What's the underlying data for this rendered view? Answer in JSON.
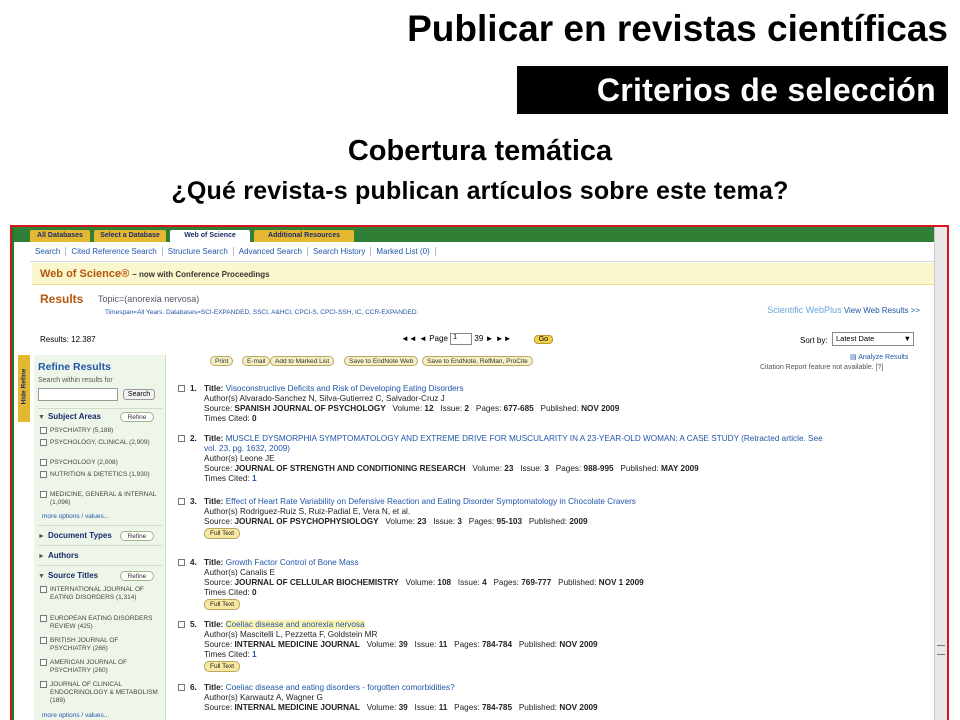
{
  "slide": {
    "title": "Publicar en revistas científicas",
    "section": "Criterios de selección",
    "subtitle": "Cobertura temática",
    "question": "¿Qué revista-s publican artículos sobre este tema?"
  },
  "tabs": [
    "All Databases",
    "Select a Database",
    "Web of Science",
    "Additional Resources"
  ],
  "nav": [
    "Search",
    "Cited Reference Search",
    "Structure Search",
    "Advanced Search",
    "Search History",
    "Marked List (0)"
  ],
  "wos": {
    "brand": "Web of Science®",
    "tagline": "– now with Conference Proceedings"
  },
  "results_header": {
    "label": "Results",
    "topic": "Topic=(anorexia nervosa)",
    "timespan": "Timespan=All Years. Databases=SCI-EXPANDED, SSCI, A&HCI, CPCI-S, CPCI-SSH, IC, CCR-EXPANDED.",
    "webplus_logo": "Scientific WebPlus",
    "webplus_link": "View Web Results >>",
    "count": "Results: 12.387",
    "page_label": "Page",
    "page_value": "1",
    "page_total": "39",
    "go": "Go",
    "sort_label": "Sort by:",
    "sort_value": "Latest Date"
  },
  "hide_refine": "Hide Refine",
  "sidebar": {
    "title": "Refine Results",
    "search_within": "Search within results for",
    "search_btn": "Search",
    "refine": "Refine",
    "subject_areas": "Subject Areas",
    "subject_items": [
      "PSYCHIATRY (5,188)",
      "PSYCHOLOGY, CLINICAL (2,909)",
      "PSYCHOLOGY (2,008)",
      "NUTRITION & DIETETICS (1,930)",
      "MEDICINE, GENERAL & INTERNAL (1,096)"
    ],
    "more": "more options / values...",
    "document_types": "Document Types",
    "authors": "Authors",
    "source_titles": "Source Titles",
    "source_items": [
      "INTERNATIONAL JOURNAL OF EATING DISORDERS (1,314)",
      "EUROPEAN EATING DISORDERS REVIEW (425)",
      "BRITISH JOURNAL OF PSYCHIATRY (266)",
      "AMERICAN JOURNAL OF PSYCHIATRY (260)",
      "JOURNAL OF CLINICAL ENDOCRINOLOGY & METABOLISM (189)"
    ]
  },
  "toolbar": {
    "print": "Print",
    "email": "E-mail",
    "marked": "Add to Marked List",
    "save_endnote_web": "Save to EndNote Web",
    "save_endnote": "Save to EndNote, RefMan, ProCite",
    "analyze": "Analyze Results",
    "citation": "Citation Report feature not available. [?]"
  },
  "results": [
    {
      "n": "1.",
      "title": "Visoconstructive Deficits and Risk of Developing Eating Disorders",
      "authors": "Author(s) Alvarado-Sanchez N, Silva-Gutierrez C, Salvador-Cruz J",
      "source": "SPANISH JOURNAL OF PSYCHOLOGY",
      "volume": "12",
      "issue": "2",
      "pages": "677-685",
      "published": "NOV 2009",
      "cited": "0"
    },
    {
      "n": "2.",
      "title": "MUSCLE DYSMORPHIA SYMPTOMATOLOGY AND EXTREME DRIVE FOR MUSCULARITY IN A 23-YEAR-OLD WOMAN: A CASE STUDY (Retracted article. See vol. 23, pg. 1632, 2009)",
      "authors": "Author(s) Leone JE",
      "source": "JOURNAL OF STRENGTH AND CONDITIONING RESEARCH",
      "volume": "23",
      "issue": "3",
      "pages": "988-995",
      "published": "MAY 2009",
      "cited": "1"
    },
    {
      "n": "3.",
      "title": "Effect of Heart Rate Variability on Defensive Reaction and Eating Disorder Symptomatology in Chocolate Cravers",
      "authors": "Author(s) Rodriguez-Ruiz S, Ruiz-Padial E, Vera N, et al.",
      "source": "JOURNAL OF PSYCHOPHYSIOLOGY",
      "volume": "23",
      "issue": "3",
      "pages": "95-103",
      "published": "2009",
      "cited": ""
    },
    {
      "n": "4.",
      "title": "Growth Factor Control of Bone Mass",
      "authors": "Author(s) Canalis E",
      "source": "JOURNAL OF CELLULAR BIOCHEMISTRY",
      "volume": "108",
      "issue": "4",
      "pages": "769-777",
      "published": "NOV 1 2009",
      "cited": "0"
    },
    {
      "n": "5.",
      "title": "Coeliac disease and anorexia nervosa",
      "authors": "Author(s) Mascitelli L, Pezzetta F, Goldstein MR",
      "source": "INTERNAL MEDICINE JOURNAL",
      "volume": "39",
      "issue": "11",
      "pages": "784-784",
      "published": "NOV 2009",
      "cited": "1"
    },
    {
      "n": "6.",
      "title": "Coeliac disease and eating disorders - forgotten comorbidities?",
      "authors": "Author(s) Karwautz A, Wagner G",
      "source": "INTERNAL MEDICINE JOURNAL",
      "volume": "39",
      "issue": "11",
      "pages": "784-785",
      "published": "NOV 2009",
      "cited": ""
    }
  ],
  "labels": {
    "title": "Title:",
    "source": "Source:",
    "volume": "Volume:",
    "issue": "Issue:",
    "pages": "Pages:",
    "published": "Published:",
    "cited": "Times Cited:",
    "fulltext": "Full Text"
  }
}
